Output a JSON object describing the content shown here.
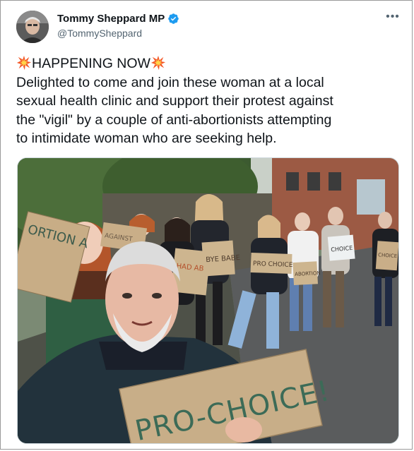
{
  "author": {
    "display_name": "Tommy Sheppard MP",
    "handle": "@TommySheppard",
    "verified": true,
    "avatar_icon": "avatar-photo"
  },
  "menu": {
    "more_label": "•••"
  },
  "tweet": {
    "emoji_icon": "collision-icon",
    "headline": "HAPPENING NOW",
    "lines": [
      "Delighted to come and join these woman at a local",
      "sexual health clinic and support their protest against",
      "the \"vigil\" by a couple of anti-abortionists attempting",
      "to intimidate woman who are seeking help."
    ]
  },
  "media": {
    "signs": {
      "main": "PRO-CHOICE!",
      "left": "ORTION A",
      "left_top": "AGAINST",
      "had": "HAD ABORTION",
      "bye": "BYE BABE",
      "middle": "PRO CHOICE",
      "right_small": "ABORTION",
      "right_far": "CHOICE",
      "far_right": "CHOICE"
    }
  },
  "colors": {
    "accent": "#1d9bf0",
    "text": "#0f1419",
    "secondary": "#536471",
    "border": "#cfd9de"
  }
}
